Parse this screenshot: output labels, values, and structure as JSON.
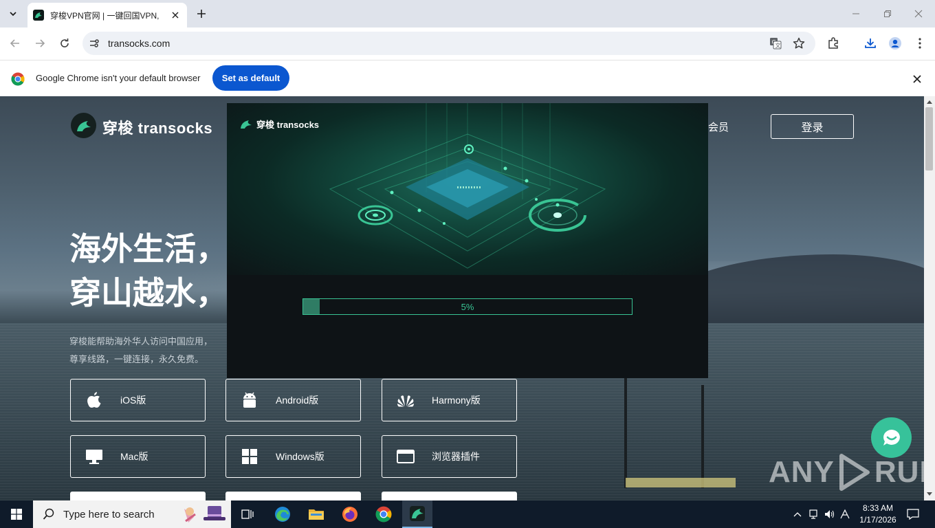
{
  "browser": {
    "tab_title": "穿梭VPN官网 | 一键回国VPN,",
    "url": "transocks.com",
    "infobar": {
      "message": "Google Chrome isn't your default browser",
      "button": "Set as default"
    }
  },
  "site": {
    "brand": "穿梭 transocks",
    "nav_member": "会员",
    "login": "登录",
    "hero_line1": "海外生活，",
    "hero_line2": "穿山越水，",
    "desc_line1": "穿梭能帮助海外华人访问中国应用，",
    "desc_line2": "尊享线路，一键连接，永久免费。",
    "downloads": [
      {
        "label": "iOS版",
        "icon": "apple-icon"
      },
      {
        "label": "Android版",
        "icon": "android-icon"
      },
      {
        "label": "Harmony版",
        "icon": "huawei-icon"
      },
      {
        "label": "Mac版",
        "icon": "monitor-icon"
      },
      {
        "label": "Windows版",
        "icon": "windows-icon"
      },
      {
        "label": "浏览器插件",
        "icon": "browser-icon"
      }
    ]
  },
  "installer": {
    "logo_text": "穿梭 transocks",
    "progress_percent": 5,
    "progress_label": "5%"
  },
  "watermark": "ANY RUN",
  "taskbar": {
    "search_placeholder": "Type here to search",
    "time": "8:33 AM",
    "date": "1/17/2026"
  },
  "colors": {
    "accent_green": "#39c494",
    "chrome_blue": "#0b57d0",
    "taskbar": "#0f1b2a"
  }
}
